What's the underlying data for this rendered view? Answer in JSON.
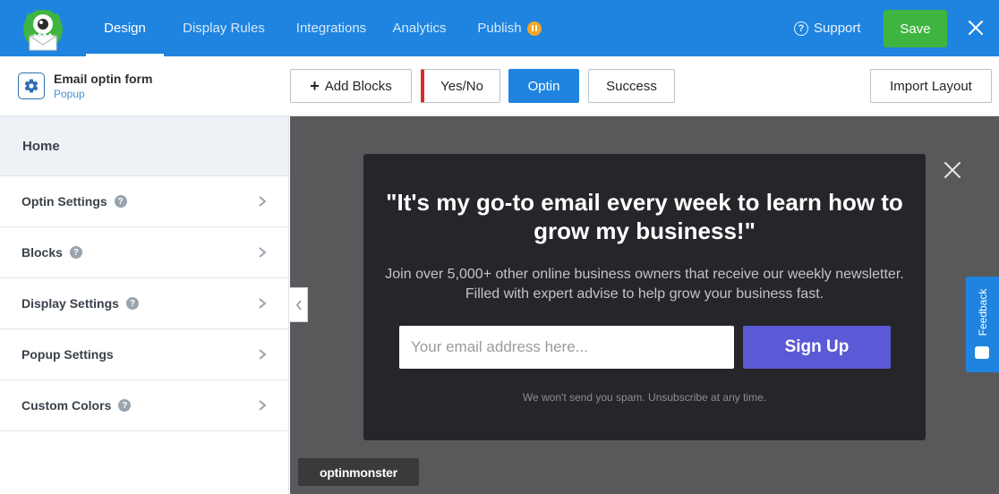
{
  "topbar": {
    "nav": [
      {
        "label": "Design",
        "active": true
      },
      {
        "label": "Display Rules"
      },
      {
        "label": "Integrations"
      },
      {
        "label": "Analytics"
      },
      {
        "label": "Publish",
        "badge": "pause-icon"
      }
    ],
    "support_label": "Support",
    "save_label": "Save",
    "brand_color": "#1e84e0",
    "save_color": "#3fb541"
  },
  "subbar": {
    "form_title": "Email optin form",
    "form_type": "Popup",
    "add_blocks_label": "Add Blocks",
    "views": [
      {
        "label": "Yes/No"
      },
      {
        "label": "Optin",
        "active": true
      },
      {
        "label": "Success"
      }
    ],
    "import_label": "Import Layout"
  },
  "sidebar": {
    "home_label": "Home",
    "items": [
      {
        "label": "Optin Settings",
        "help": true
      },
      {
        "label": "Blocks",
        "help": true
      },
      {
        "label": "Display Settings",
        "help": true
      },
      {
        "label": "Popup Settings",
        "help": false
      },
      {
        "label": "Custom Colors",
        "help": true
      }
    ]
  },
  "popup": {
    "headline": "\"It's my go-to email every week to learn how to grow my business!\"",
    "subtext": "Join over 5,000+ other online business owners that receive our weekly newsletter. Filled with expert advise to help grow your business fast.",
    "email_placeholder": "Your email address here...",
    "signup_label": "Sign Up",
    "nospam": "We won't send you spam. Unsubscribe at any time.",
    "signup_color": "#5b59d6"
  },
  "branding": {
    "badge_text": "optinmonster"
  },
  "feedback": {
    "label": "Feedback"
  }
}
